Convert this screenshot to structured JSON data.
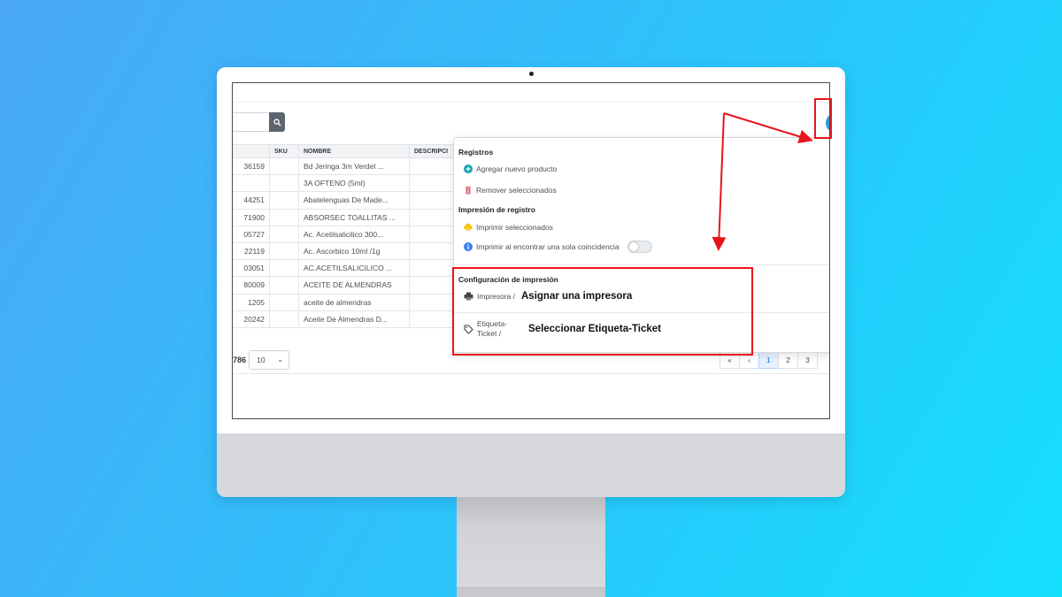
{
  "table": {
    "headers": [
      "",
      "SKU",
      "NOMBRE",
      "DESCRIPCI"
    ],
    "rows": [
      {
        "code": "36159",
        "sku": "",
        "name": "Bd Jeringa 3m Verdel ..."
      },
      {
        "code": "",
        "sku": "",
        "name": "3A OFTENO (5ml)"
      },
      {
        "code": "44251",
        "sku": "",
        "name": "Abatelenguas De Made..."
      },
      {
        "code": "71900",
        "sku": "",
        "name": "ABSORSEC TOALLITAS ..."
      },
      {
        "code": "05727",
        "sku": "",
        "name": "Ac. Acetilsalicilico 300..."
      },
      {
        "code": "22119",
        "sku": "",
        "name": "Ac. Ascorbico 10ml /1g"
      },
      {
        "code": "03051",
        "sku": "",
        "name": "AC.ACETILSALICILICO ..."
      },
      {
        "code": "80009",
        "sku": "",
        "name": "ACEITE DE ALMENDRAS"
      },
      {
        "code": "1205",
        "sku": "",
        "name": "aceite de almendras"
      },
      {
        "code": "20242",
        "sku": "",
        "name": "Aceite De Almendras D..."
      }
    ]
  },
  "footer": {
    "total_count": "786",
    "per_page": "10",
    "pagination": [
      "«",
      "‹",
      "1",
      "2",
      "3"
    ]
  },
  "menu": {
    "section_registros": "Registros",
    "add_product": "Agregar nuevo producto",
    "remove_selected": "Remover seleccionados",
    "section_impresion": "Impresión de registro",
    "print_selected": "Imprimir seleccionados",
    "print_on_single_match": "Imprimir al encontrar una sola coincidencia",
    "section_config": "Configuración de impresión",
    "printer_label": "Impresora /",
    "printer_value": "Asignar una impresora",
    "label_label_line1": "Etiqueta-",
    "label_label_line2": "Ticket /",
    "label_value": "Seleccionar Etiqueta-Ticket"
  },
  "colors": {
    "annotation_red": "#e8141c",
    "accent_blue": "#2e9bd4",
    "add_icon_teal": "#17a2b8",
    "remove_icon_red": "#e4606d",
    "print_icon_yellow": "#f5c400",
    "info_icon_blue": "#3b82f6"
  },
  "icons": {
    "search": "search-icon",
    "add": "plus-circle-icon",
    "remove": "trash-icon",
    "print": "printer-icon",
    "info": "info-icon",
    "printer_config": "printer-icon",
    "label": "tag-icon"
  }
}
